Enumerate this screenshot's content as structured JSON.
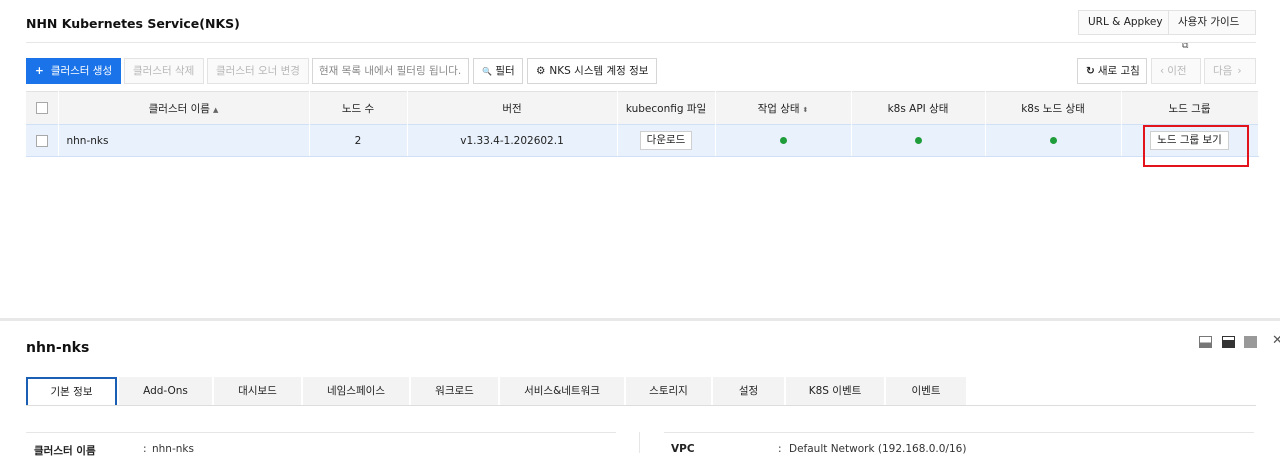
{
  "header": {
    "title": "NHN Kubernetes Service(NKS)",
    "url_appkey": "URL & Appkey",
    "user_guide": "사용자 가이드",
    "external_glyph": "⧉"
  },
  "toolbar": {
    "create": "클러스터 생성",
    "create_glyph": "+",
    "delete": "클러스터 삭제",
    "owner_change": "클러스터 오너 변경",
    "search_placeholder": "현재 목록 내에서 필터링 됩니다.",
    "filter": "필터",
    "filter_glyph": "🔍",
    "system_account": "NKS 시스템 계정 정보",
    "gear_glyph": "⚙",
    "refresh": "새로 고침",
    "refresh_glyph": "↻",
    "prev": "이전",
    "prev_glyph": "‹",
    "next": "다음",
    "next_glyph": "›"
  },
  "table": {
    "headers": [
      "클러스터 이름",
      "노드 수",
      "버전",
      "kubeconfig 파일",
      "작업 상태",
      "k8s API 상태",
      "k8s 노드 상태",
      "노드 그룹"
    ],
    "sort_glyph_up": "▲",
    "sort_glyph_both": "⬍",
    "rows": [
      {
        "name": "nhn-nks",
        "node_count": "2",
        "version": "v1.33.4-1.202602.1",
        "kubeconfig": "다운로드",
        "node_group": "노드 그룹 보기"
      }
    ],
    "status_color": "#1f9d3a"
  },
  "detail": {
    "title": "nhn-nks",
    "close_glyph": "✕",
    "tabs": [
      "기본 정보",
      "Add-Ons",
      "대시보드",
      "네임스페이스",
      "워크로드",
      "서비스&네트워크",
      "스토리지",
      "설정",
      "K8S 이벤트",
      "이벤트"
    ],
    "left_key": "클러스터 이름",
    "left_value": "nhn-nks",
    "right_key": "VPC",
    "right_value": "Default Network (192.168.0.0/16)",
    "sep": ":"
  },
  "colors": {
    "primary": "#1a73e8",
    "highlight": "#e2131a",
    "active_tab": "#1a5fb4"
  }
}
